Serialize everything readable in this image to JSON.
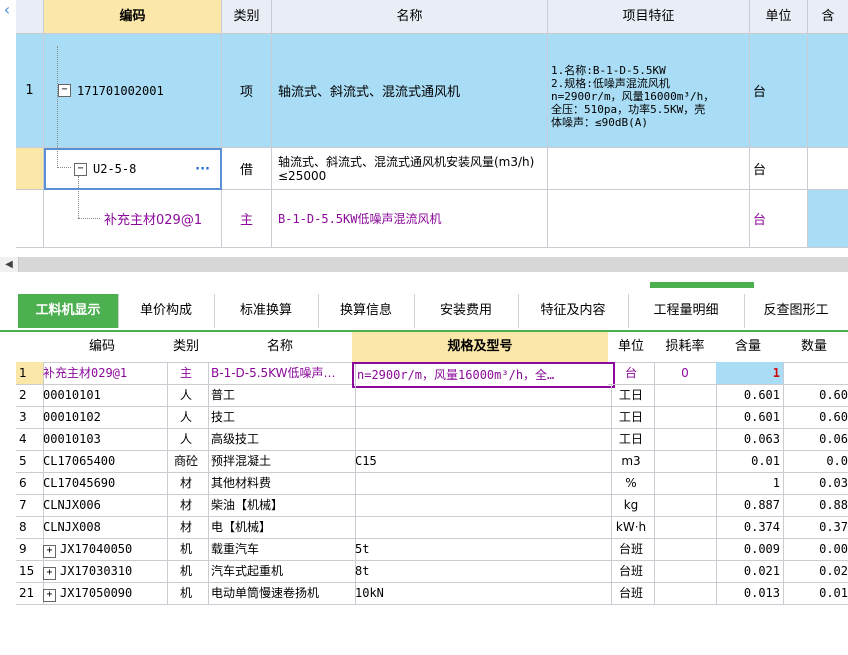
{
  "top_table": {
    "headers": [
      "编码",
      "类别",
      "名称",
      "项目特征",
      "单位",
      "含"
    ],
    "rows": [
      {
        "num": "1",
        "code": "171701002001",
        "type": "项",
        "name": "轴流式、斜流式、混流式通风机",
        "features": [
          "1.名称:B-1-D-5.5KW",
          "2.规格:低噪声混流风机",
          "n=2900r/m，风量16000m³/h，",
          "全压：510pa，功率5.5KW，壳",
          "体噪声：≤90dB(A)"
        ],
        "unit": "台"
      },
      {
        "num": "",
        "code": "U2-5-8",
        "type": "借",
        "name": "轴流式、斜流式、混流式通风机安装风量(m3/h) ≤25000",
        "features": [],
        "unit": "台"
      },
      {
        "num": "",
        "code": "补充主材029@1",
        "type": "主",
        "name": "B-1-D-5.5KW低噪声混流风机",
        "features": [],
        "unit": "台"
      }
    ]
  },
  "tabs": [
    "工料机显示",
    "单价构成",
    "标准换算",
    "换算信息",
    "安装费用",
    "特征及内容",
    "工程量明细",
    "反查图形工"
  ],
  "bottom_table": {
    "headers": [
      "编码",
      "类别",
      "名称",
      "规格及型号",
      "单位",
      "损耗率",
      "含量",
      "数量"
    ],
    "rows": [
      {
        "num": "1",
        "expand": false,
        "code": "补充主材029@1",
        "type": "主",
        "name": "B-1-D-5.5KW低噪声…",
        "spec": "n=2900r/m，风量16000m³/h，全…",
        "unit": "台",
        "loss": "0",
        "qty": "1",
        "amount": ""
      },
      {
        "num": "2",
        "expand": false,
        "code": "00010101",
        "type": "人",
        "name": "普工",
        "spec": "",
        "unit": "工日",
        "loss": "",
        "qty": "0.601",
        "amount": "0.60"
      },
      {
        "num": "3",
        "expand": false,
        "code": "00010102",
        "type": "人",
        "name": "技工",
        "spec": "",
        "unit": "工日",
        "loss": "",
        "qty": "0.601",
        "amount": "0.60"
      },
      {
        "num": "4",
        "expand": false,
        "code": "00010103",
        "type": "人",
        "name": "高级技工",
        "spec": "",
        "unit": "工日",
        "loss": "",
        "qty": "0.063",
        "amount": "0.06"
      },
      {
        "num": "5",
        "expand": false,
        "code": "CL17065400",
        "type": "商砼",
        "name": "预拌混凝土",
        "spec": "C15",
        "unit": "m3",
        "loss": "",
        "qty": "0.01",
        "amount": "0.0"
      },
      {
        "num": "6",
        "expand": false,
        "code": "CL17045690",
        "type": "材",
        "name": "其他材料费",
        "spec": "",
        "unit": "%",
        "loss": "",
        "qty": "1",
        "amount": "0.03"
      },
      {
        "num": "7",
        "expand": false,
        "code": "CLNJX006",
        "type": "材",
        "name": "柴油【机械】",
        "spec": "",
        "unit": "kg",
        "loss": "",
        "qty": "0.887",
        "amount": "0.88"
      },
      {
        "num": "8",
        "expand": false,
        "code": "CLNJX008",
        "type": "材",
        "name": "电【机械】",
        "spec": "",
        "unit": "kW·h",
        "loss": "",
        "qty": "0.374",
        "amount": "0.37"
      },
      {
        "num": "9",
        "expand": true,
        "code": "JX17040050",
        "type": "机",
        "name": "载重汽车",
        "spec": "5t",
        "unit": "台班",
        "loss": "",
        "qty": "0.009",
        "amount": "0.00"
      },
      {
        "num": "15",
        "expand": true,
        "code": "JX17030310",
        "type": "机",
        "name": "汽车式起重机",
        "spec": "8t",
        "unit": "台班",
        "loss": "",
        "qty": "0.021",
        "amount": "0.02"
      },
      {
        "num": "21",
        "expand": true,
        "code": "JX17050090",
        "type": "机",
        "name": "电动单筒慢速卷扬机",
        "spec": "10kN",
        "unit": "台班",
        "loss": "",
        "qty": "0.013",
        "amount": "0.01"
      }
    ]
  },
  "colors": {
    "accent_green": "#4caf50",
    "row_selected": "#a9dcf5",
    "header_selected": "#fbe7a8",
    "purple_text": "#8b0a9a"
  }
}
